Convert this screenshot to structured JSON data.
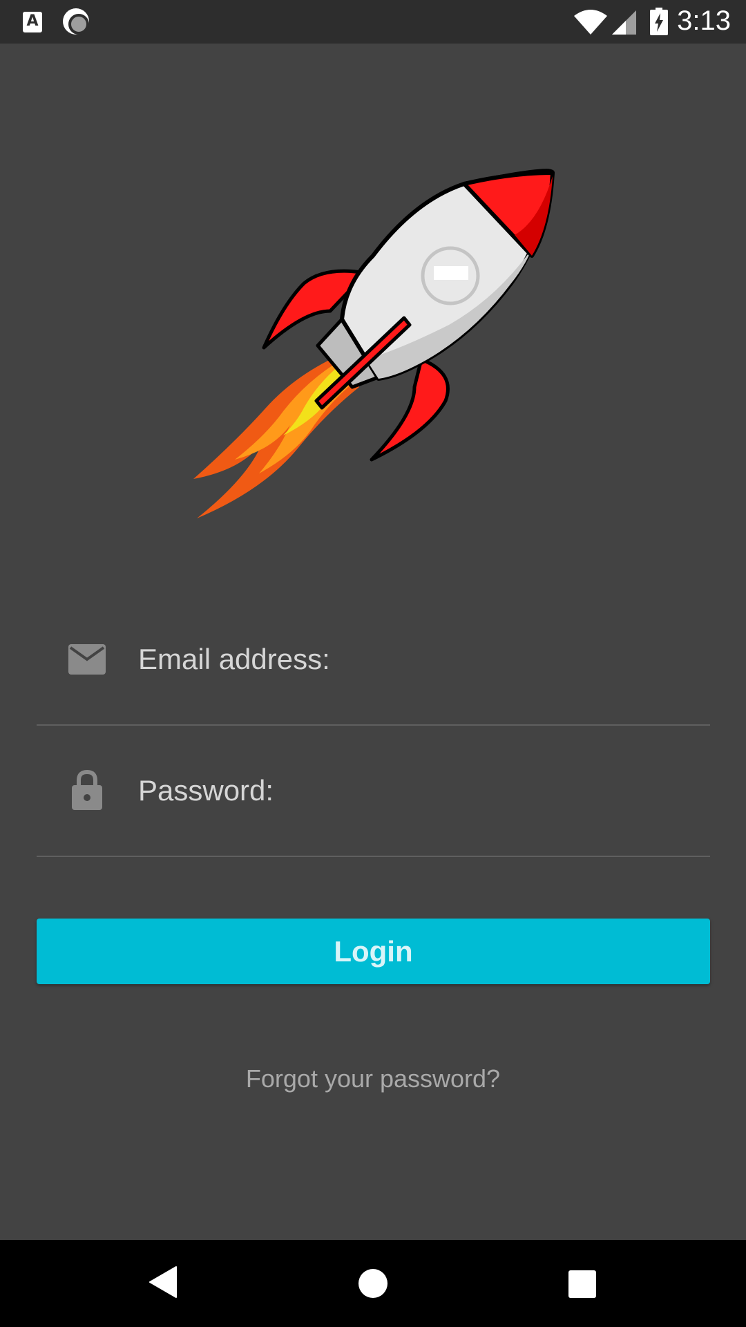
{
  "status_bar": {
    "clock": "3:13",
    "icons": [
      "text-a-icon",
      "record-icon",
      "wifi-icon",
      "signal-icon",
      "battery-charging-icon"
    ],
    "a_letter": "A"
  },
  "logo": {
    "icon": "rocket-icon"
  },
  "form": {
    "email_label": "Email address:",
    "email_icon": "mail-icon",
    "password_label": "Password:",
    "password_icon": "lock-icon",
    "login_label": "Login",
    "forgot_label": "Forgot your password?"
  },
  "nav_bar": {
    "icons": [
      "back-icon",
      "home-icon",
      "recents-icon"
    ]
  },
  "colors": {
    "background": "#434343",
    "status_bar": "#2d2d2d",
    "accent": "#00bcd4",
    "nav_bar": "#000000",
    "rocket_red": "#ff1a1a",
    "rocket_flame": "#f05a14"
  }
}
